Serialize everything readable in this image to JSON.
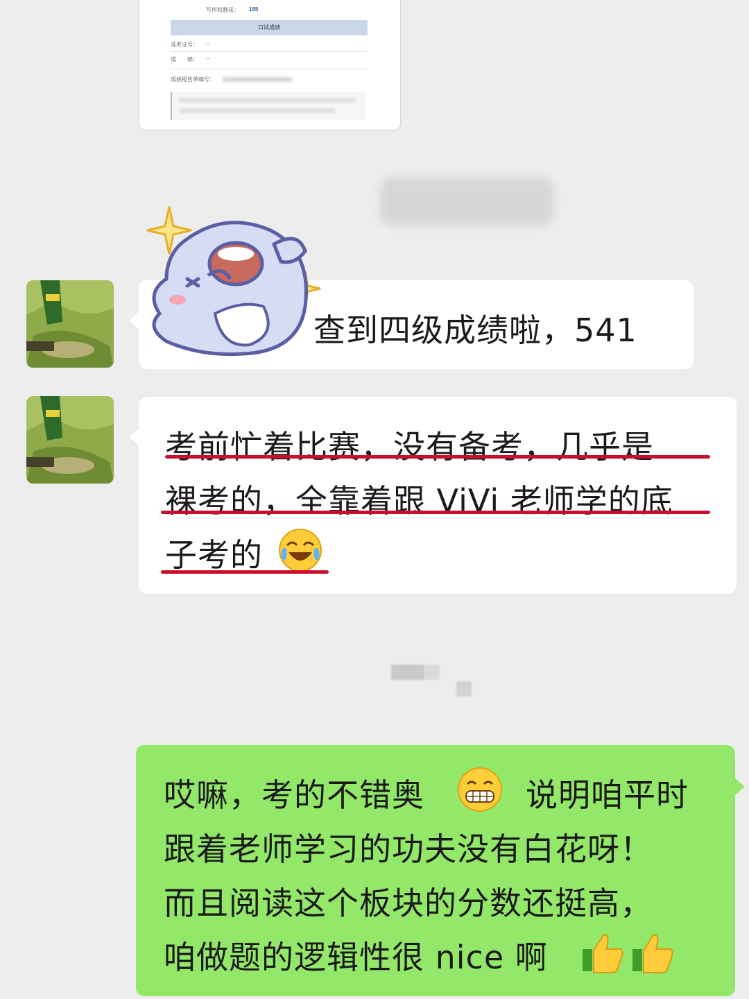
{
  "shared_image": {
    "count_label": "写作和翻译：",
    "count_value": "155",
    "section_header": "口试成绩",
    "exam_id_label": "准考证号：",
    "exam_id_value": "--",
    "score_label": "成　　绩：",
    "score_value": "--",
    "report_no_label": "成绩报告单编号："
  },
  "messages": [
    {
      "sender": "other",
      "lines": [
        "查到四级成绩啦，541"
      ],
      "sticker": "crying-laughing-seal-sticker"
    },
    {
      "sender": "other",
      "lines": [
        "考前忙着比赛，没有备考，几乎是",
        "裸考的，全靠着跟 ViVi 老师学的底",
        "子考的"
      ],
      "trailing_emoji": "face-with-tears-of-joy-emoji",
      "highlighted": true
    },
    {
      "sender": "self",
      "lines": [
        "哎嘛，考的不错奥",
        "说明咱平时",
        "跟着老师学习的功夫没有白花呀！",
        "而且阅读这个板块的分数还挺高，",
        "咱做题的逻辑性很 nice 啊"
      ],
      "emojis": [
        "grinning-face-emoji",
        "thumbs-up-emoji",
        "thumbs-up-emoji"
      ]
    }
  ],
  "colors": {
    "background": "#ededed",
    "self_bubble": "#94e869",
    "other_bubble": "#ffffff",
    "highlight_underline": "#c8102e"
  }
}
